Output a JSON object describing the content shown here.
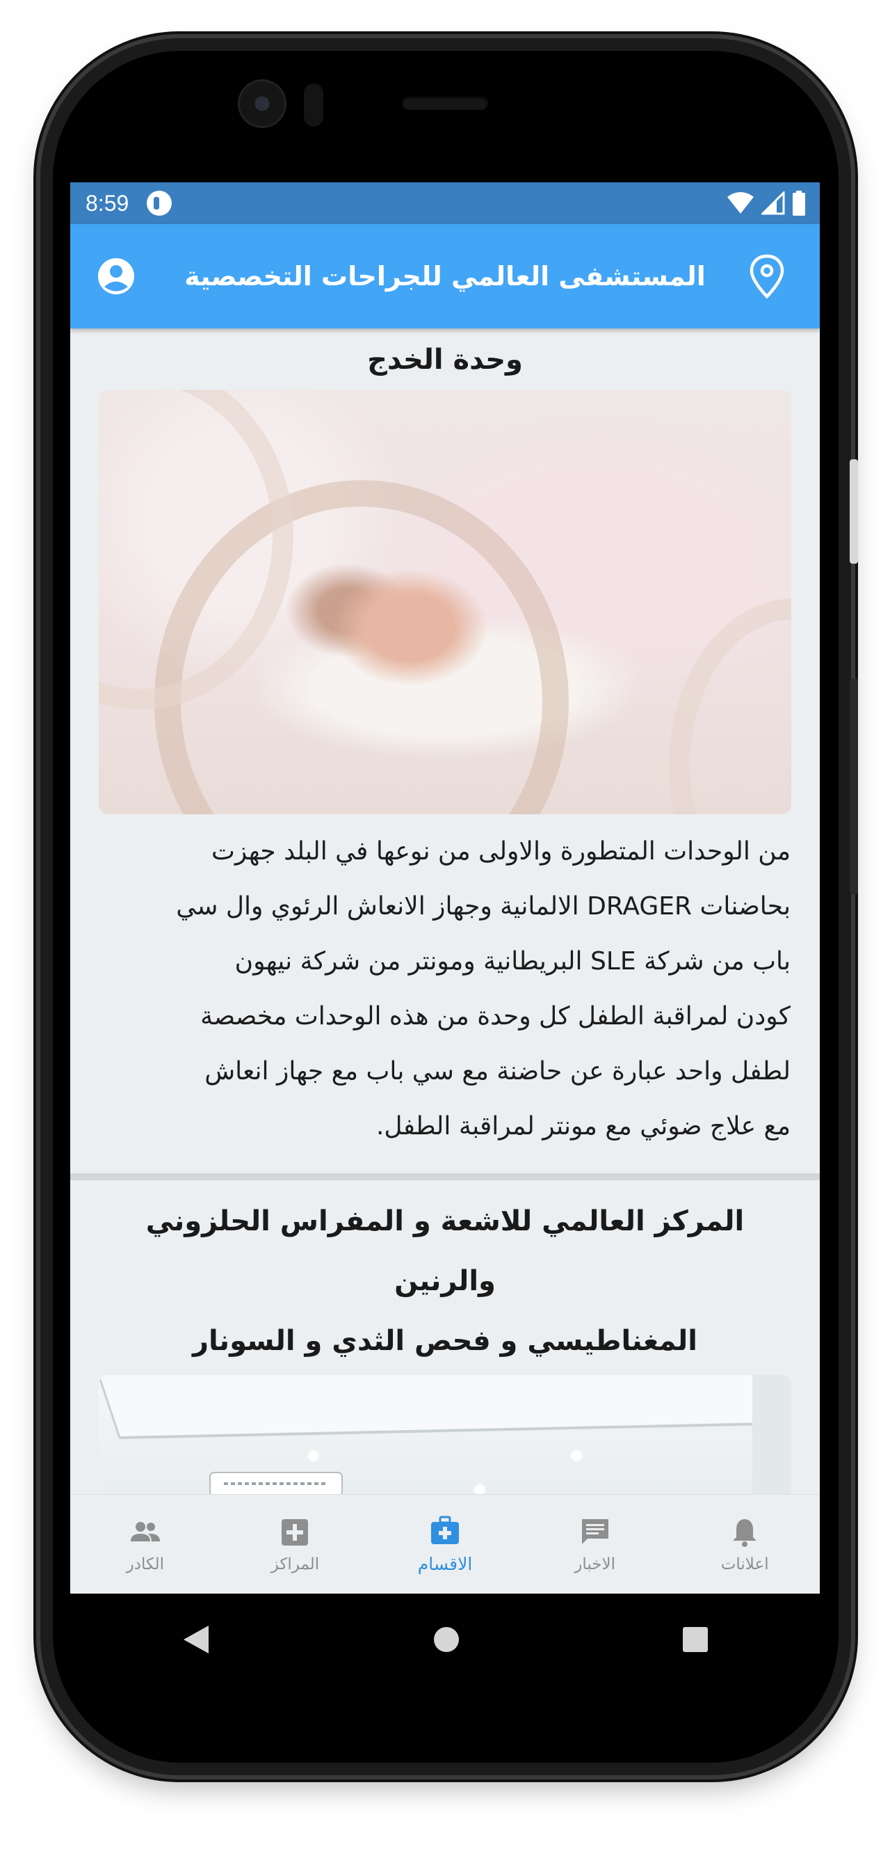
{
  "status_bar": {
    "time": "8:59",
    "icons": [
      "app-notification-icon",
      "wifi-icon",
      "signal-icon",
      "battery-icon"
    ]
  },
  "app_bar": {
    "title": "المستشفى العالمي للجراحات التخصصية",
    "left_icon": "account-circle-icon",
    "right_icon": "location-pin-icon",
    "background": "#42a5f5"
  },
  "sections": [
    {
      "title": "وحدة الخدج",
      "image": "incubator-baby-photo",
      "body_lines": [
        "من الوحدات المتطورة والاولى من نوعها في البلد جهزت",
        "بحاضنات DRAGER الالمانية وجهاز الانعاش الرئوي وال سي",
        "باب من شركة SLE البريطانية ومونتر من شركة نيهون",
        "كودن لمراقبة الطفل كل وحدة من هذه الوحدات مخصصة",
        "لطفل واحد عبارة عن حاضنة مع سي باب مع جهاز انعاش",
        "مع علاج ضوئي مع مونتر لمراقبة الطفل."
      ]
    },
    {
      "title_lines": [
        "المركز العالمي للاشعة و المفراس الحلزوني والرنين",
        "المغناطيسي و فحص الثدي و السونار"
      ],
      "image": "radiology-room-photo"
    }
  ],
  "bottom_nav": {
    "active_color": "#2f8fe0",
    "inactive_color": "#8e8e8e",
    "items": [
      {
        "label": "اعلانات",
        "icon": "bell-icon"
      },
      {
        "label": "الاخبار",
        "icon": "chat-message-icon"
      },
      {
        "label": "الاقسام",
        "icon": "medical-kit-icon",
        "active": true
      },
      {
        "label": "المراكز",
        "icon": "hospital-cross-icon"
      },
      {
        "label": "الكادر",
        "icon": "people-icon"
      }
    ]
  }
}
